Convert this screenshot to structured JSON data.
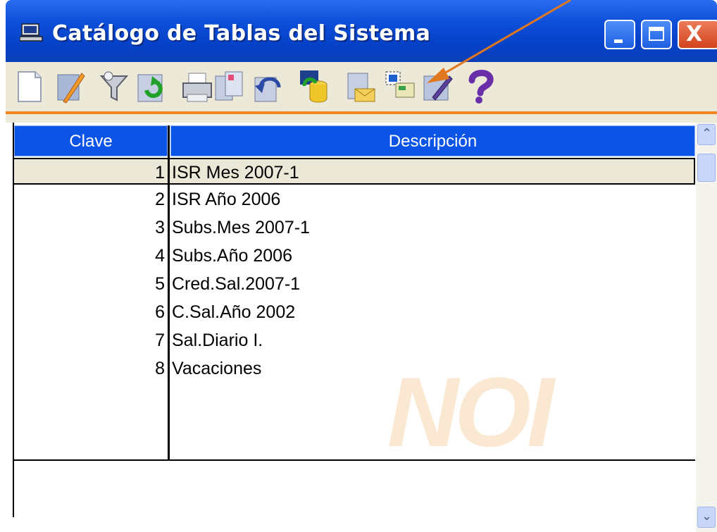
{
  "window": {
    "title": "Catálogo de Tablas del Sistema",
    "controls": {
      "minimize": "minimize",
      "maximize": "maximize",
      "close": "X"
    }
  },
  "toolbar": {
    "buttons": [
      "new-document-icon",
      "edit-icon",
      "filter-icon",
      "refresh-icon",
      "print-icon",
      "copy-table-icon",
      "undo-icon",
      "database-update-icon",
      "export-icon",
      "select-table-icon",
      "edit-sheet-icon",
      "help-icon"
    ],
    "accent_color": "#f08a1e"
  },
  "grid": {
    "columns": {
      "clave": "Clave",
      "descripcion": "Descripción"
    },
    "rows": [
      {
        "clave": "1",
        "descripcion": "ISR Mes 2007-1"
      },
      {
        "clave": "2",
        "descripcion": "ISR Año 2006"
      },
      {
        "clave": "3",
        "descripcion": "Subs.Mes 2007-1"
      },
      {
        "clave": "4",
        "descripcion": "Subs.Año 2006"
      },
      {
        "clave": "5",
        "descripcion": "Cred.Sal.2007-1"
      },
      {
        "clave": "6",
        "descripcion": "C.Sal.Año 2002"
      },
      {
        "clave": "7",
        "descripcion": "Sal.Diario I."
      },
      {
        "clave": "8",
        "descripcion": "Vacaciones"
      }
    ],
    "selected_row": 1,
    "header_color": "#0c54e6"
  },
  "watermark": {
    "text": "NOI"
  },
  "annotation": {
    "color": "#e07820"
  }
}
